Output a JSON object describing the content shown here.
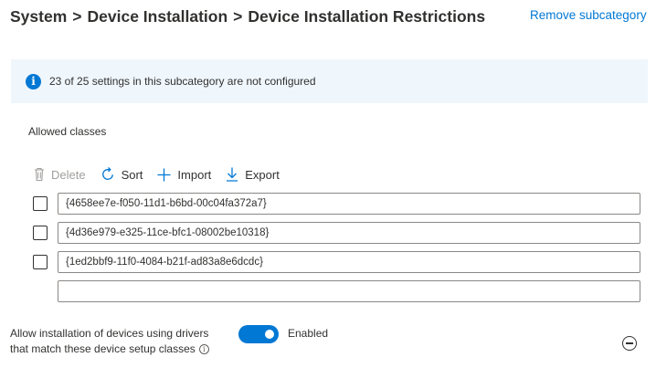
{
  "breadcrumb": {
    "parts": [
      "System",
      "Device Installation",
      "Device Installation Restrictions"
    ],
    "separator": ">"
  },
  "remove_link": "Remove subcategory",
  "info_bar": {
    "icon": "info-icon",
    "text": "23 of 25 settings in this subcategory are not configured"
  },
  "section_label": "Allowed classes",
  "toolbar": {
    "delete_label": "Delete",
    "sort_label": "Sort",
    "import_label": "Import",
    "export_label": "Export"
  },
  "rows": [
    {
      "value": "{4658ee7e-f050-11d1-b6bd-00c04fa372a7}",
      "checked": false
    },
    {
      "value": "{4d36e979-e325-11ce-bfc1-08002be10318}",
      "checked": false
    },
    {
      "value": "{1ed2bbf9-11f0-4084-b21f-ad83a8e6dcdc}",
      "checked": false
    }
  ],
  "new_row": {
    "value": "",
    "placeholder": ""
  },
  "setting": {
    "label_line1": "Allow installation of devices using drivers",
    "label_line2": "that match these device setup classes",
    "toggle_state": "Enabled",
    "enabled": true
  },
  "colors": {
    "accent": "#0078d4",
    "info_background": "#eff6fc"
  }
}
